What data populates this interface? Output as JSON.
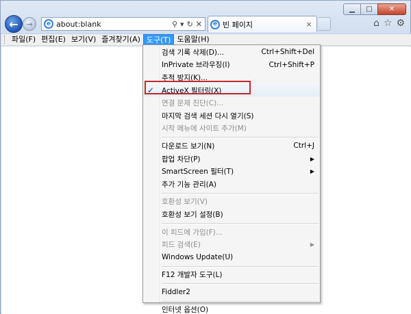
{
  "address": {
    "url": "about:blank",
    "search_icon": "search-icon",
    "refresh_icon": "refresh-icon",
    "stop_icon": "stop-icon"
  },
  "tab": {
    "title": "빈 페이지",
    "close": "×"
  },
  "toolbar_icons": [
    "home-icon",
    "star-icon",
    "gear-icon"
  ],
  "menubar": [
    {
      "label": "파일(F)"
    },
    {
      "label": "편집(E)"
    },
    {
      "label": "보기(V)"
    },
    {
      "label": "즐겨찾기(A)"
    },
    {
      "label": "도구(T)",
      "active": true
    },
    {
      "label": "도움말(H)"
    }
  ],
  "tools_menu": [
    {
      "label": "검색 기록 삭제(D)...",
      "shortcut": "Ctrl+Shift+Del"
    },
    {
      "label": "InPrivate 브라우징(I)",
      "shortcut": "Ctrl+Shift+P"
    },
    {
      "label": "추적 방지(K)..."
    },
    {
      "label": "ActiveX 필터링(X)",
      "checked": true,
      "highlighted": true
    },
    {
      "label": "연결 문제 진단(C)...",
      "disabled": true
    },
    {
      "label": "마지막 검색 세션 다시 열기(S)"
    },
    {
      "label": "시작 메뉴에 사이트 추가(M)",
      "disabled": true
    },
    {
      "separator": true
    },
    {
      "label": "다운로드 보기(N)",
      "shortcut": "Ctrl+J"
    },
    {
      "label": "팝업 차단(P)",
      "submenu": true
    },
    {
      "label": "SmartScreen 필터(T)",
      "submenu": true
    },
    {
      "label": "추가 기능 관리(A)"
    },
    {
      "separator": true
    },
    {
      "label": "호환성 보기(V)",
      "disabled": true
    },
    {
      "label": "호환성 보기 설정(B)"
    },
    {
      "separator": true
    },
    {
      "label": "이 피드에 가입(F)...",
      "disabled": true
    },
    {
      "label": "피드 검색(E)",
      "disabled": true,
      "submenu": true
    },
    {
      "label": "Windows Update(U)"
    },
    {
      "separator": true
    },
    {
      "label": "F12 개발자 도구(L)"
    },
    {
      "separator": true
    },
    {
      "label": "Fiddler2"
    },
    {
      "separator": true
    },
    {
      "label": "인터넷 옵션(O)"
    }
  ]
}
